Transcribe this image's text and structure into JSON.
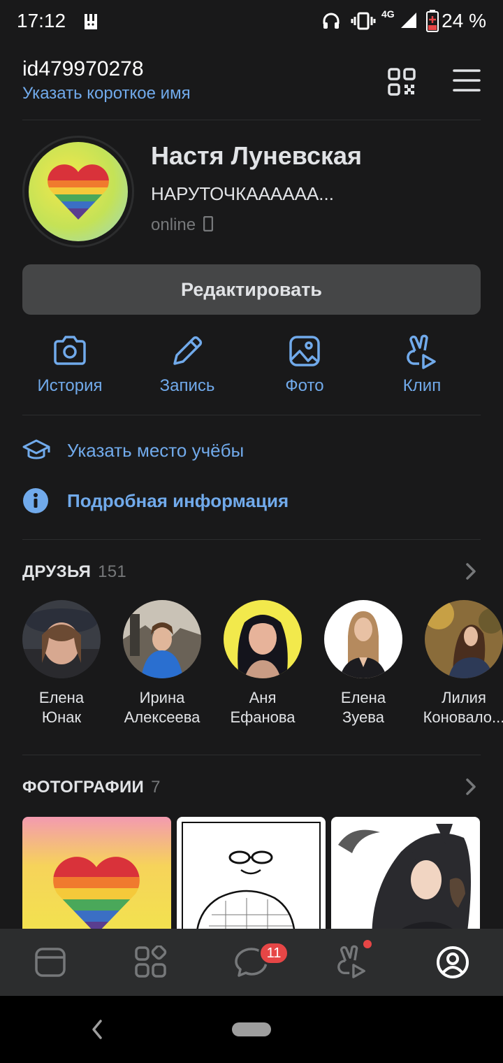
{
  "status_bar": {
    "time": "17:12",
    "network": "4G",
    "battery": "24 %"
  },
  "header": {
    "user_id": "id479970278",
    "short_name_link": "Указать короткое имя"
  },
  "profile": {
    "name": "Настя Луневская",
    "status": "НАРУТОЧКАААААА...",
    "online": "online"
  },
  "edit_button": "Редактировать",
  "actions": [
    {
      "label": "История",
      "icon": "camera-icon"
    },
    {
      "label": "Запись",
      "icon": "pencil-icon"
    },
    {
      "label": "Фото",
      "icon": "image-icon"
    },
    {
      "label": "Клип",
      "icon": "clip-icon"
    }
  ],
  "info": {
    "education": "Указать место учёбы",
    "details": "Подробная информация"
  },
  "friends": {
    "title": "ДРУЗЬЯ",
    "count": "151",
    "items": [
      {
        "first": "Елена",
        "last": "Юнак"
      },
      {
        "first": "Ирина",
        "last": "Алексеева"
      },
      {
        "first": "Аня",
        "last": "Ефанова"
      },
      {
        "first": "Елена",
        "last": "Зуева"
      },
      {
        "first": "Лилия",
        "last": "Коновало..."
      }
    ]
  },
  "photos": {
    "title": "ФОТОГРАФИИ",
    "count": "7"
  },
  "tabbar": {
    "messages_badge": "11",
    "tabs": [
      "news-icon",
      "services-icon",
      "messages-icon",
      "clips-icon",
      "profile-icon"
    ]
  },
  "colors": {
    "accent": "#71aaeb",
    "background": "#19191a",
    "badge": "#e64646"
  }
}
